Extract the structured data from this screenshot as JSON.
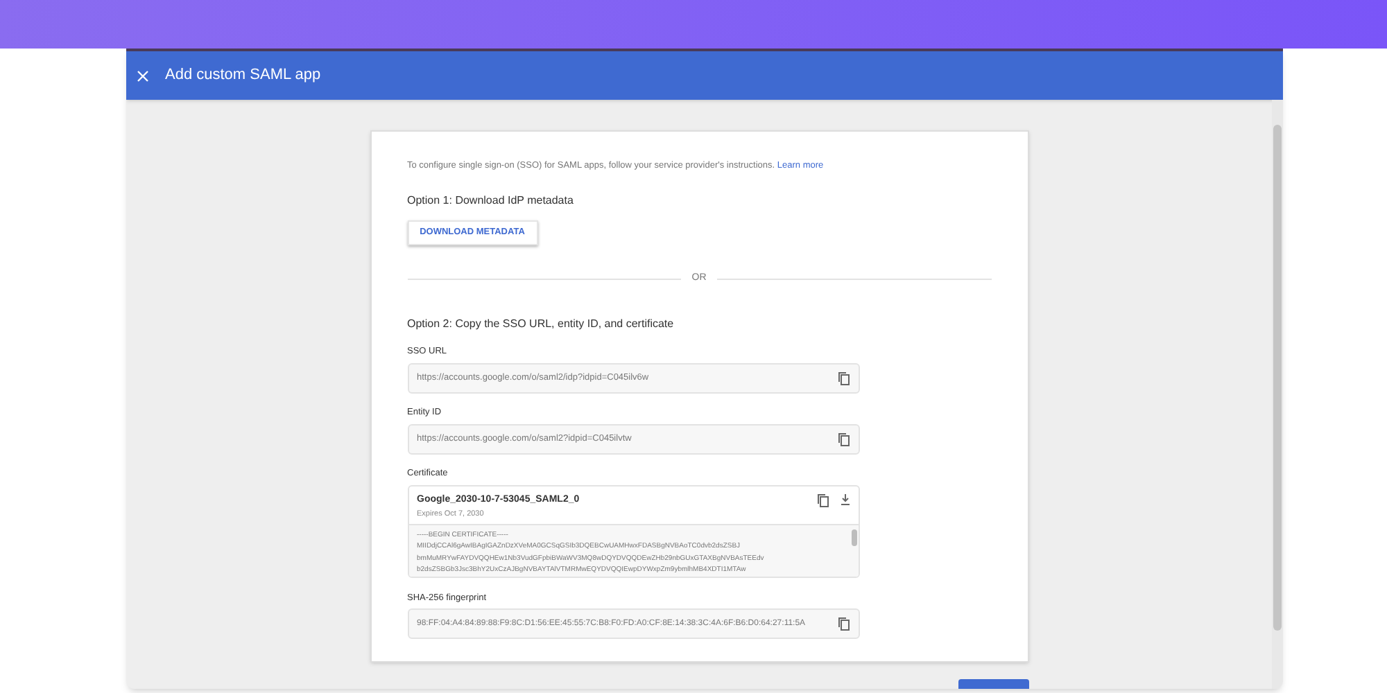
{
  "dialog": {
    "title": "Add custom SAML app"
  },
  "intro": {
    "text": "To configure single sign-on (SSO) for SAML apps, follow your service provider's instructions.",
    "link": "Learn more"
  },
  "option_1": {
    "heading": "Option 1: Download IdP metadata",
    "button": "DOWNLOAD METADATA"
  },
  "divider_label": "OR",
  "option_2": {
    "heading": "Option 2: Copy the SSO URL, entity ID, and certificate"
  },
  "fields": [
    {
      "label": "SSO URL",
      "value": "https://accounts.google.com/o/saml2/idp?idpid=C045ilv6w"
    },
    {
      "label": "Entity ID",
      "value": "https://accounts.google.com/o/saml2?idpid=C045ilvtw"
    }
  ],
  "certificate": {
    "label": "Certificate",
    "name": "Google_2030-10-7-53045_SAML2_0",
    "expires": "Expires Oct 7, 2030",
    "lines": [
      "-----BEGIN CERTIFICATE-----",
      "MIIDdjCCAl6gAwIBAgIGAZnDzXVeMA0GCSqGSIb3DQEBCwUAMHwxFDASBgNVBAoTC0dvb2dsZSBJ",
      "bmMuMRYwFAYDVQQHEw1Nb3VudGFpbiBWaWV3MQ8wDQYDVQQDEwZHb29nbGUxGTAXBgNVBAsTEEdv",
      "b2dsZSBGb3Jsc3BhY2UxCzAJBgNVBAYTAlVTMRMwEQYDVQQIEwpDYWxpZm9ybmlhMB4XDTI1MTAw"
    ]
  },
  "fingerprint": {
    "label": "SHA-256 fingerprint",
    "value": "98:FF:04:A4:84:89:88:F9:8C:D1:56:EE:45:55:7C:B8:F0:FD:A0:CF:8E:14:38:3C:4A:6F:B6:D0:64:27:11:5A"
  }
}
